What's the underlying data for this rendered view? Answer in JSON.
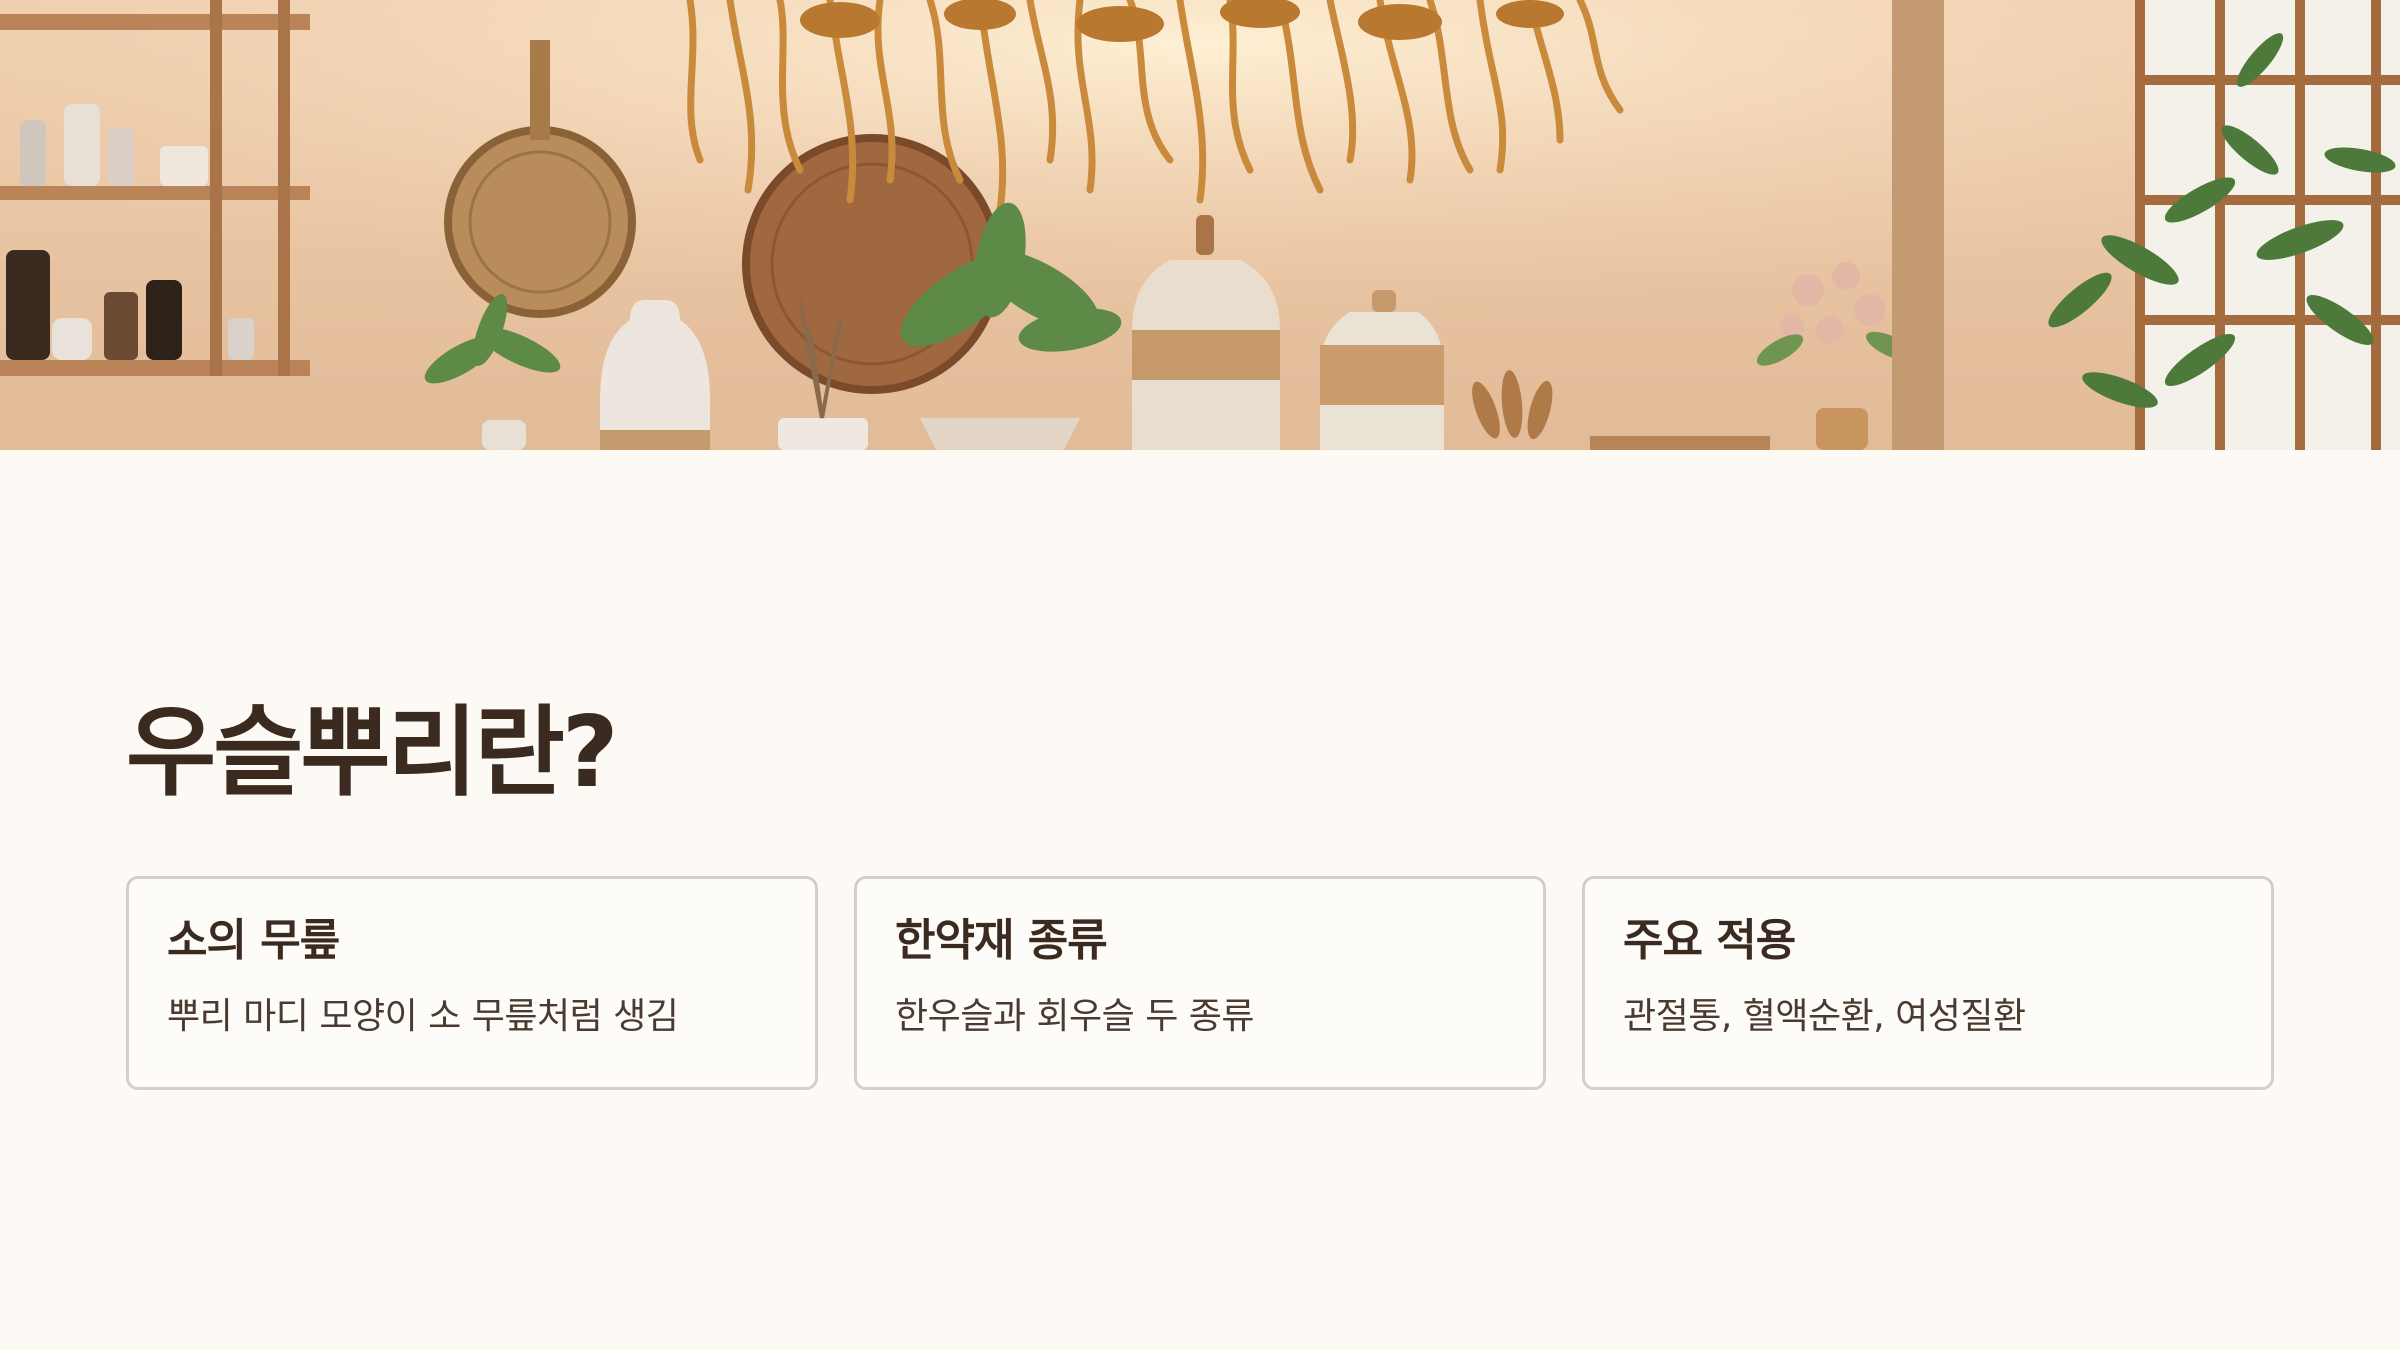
{
  "hero": {
    "image_name": "herbal-apothecary-banner",
    "colors": {
      "wall": "#f2d2b2",
      "roots": "#c98a3c",
      "shelf": "#b88458",
      "foliage": "#4d7a3a"
    }
  },
  "title": "우슬뿌리란?",
  "cards": [
    {
      "title": "소의 무릎",
      "text": "뿌리 마디 모양이 소 무릎처럼 생김"
    },
    {
      "title": "한약재 종류",
      "text": "한우슬과 회우슬 두 종류"
    },
    {
      "title": "주요 적용",
      "text": "관절통, 혈액순환, 여성질환"
    }
  ],
  "colors": {
    "background": "#fdfaf6",
    "heading": "#3b2a1f",
    "card_border": "#d4cfcb"
  }
}
